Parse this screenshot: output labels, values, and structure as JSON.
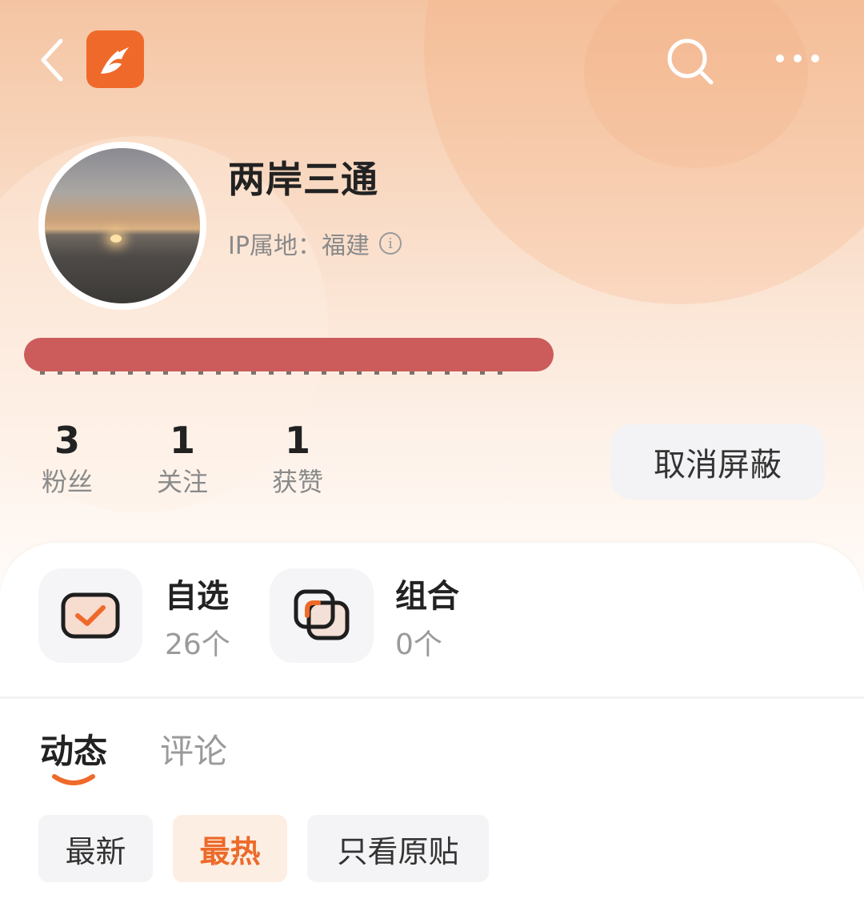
{
  "colors": {
    "accent": "#ef6a2a",
    "text_primary": "#222222",
    "text_secondary": "#8a8a8a",
    "redaction": "#cc5c5c"
  },
  "header": {
    "back_icon": "chevron-left-icon",
    "logo_icon": "app-logo-icon",
    "search_icon": "search-icon",
    "more_icon": "more-dots-icon"
  },
  "profile": {
    "username": "两岸三通",
    "ip_location": "IP属地：福建",
    "info_icon": "info-icon"
  },
  "stats": [
    {
      "value": "3",
      "label": "粉丝"
    },
    {
      "value": "1",
      "label": "关注"
    },
    {
      "value": "1",
      "label": "获赞"
    }
  ],
  "unblock_button": "取消屏蔽",
  "tiles": [
    {
      "title": "自选",
      "count": "26个",
      "icon": "watchlist-check-icon"
    },
    {
      "title": "组合",
      "count": "0个",
      "icon": "portfolio-icon"
    }
  ],
  "tabs": [
    {
      "label": "动态",
      "active": true
    },
    {
      "label": "评论",
      "active": false
    }
  ],
  "filters": [
    {
      "label": "最新",
      "active": false
    },
    {
      "label": "最热",
      "active": true
    },
    {
      "label": "只看原贴",
      "active": false
    }
  ]
}
